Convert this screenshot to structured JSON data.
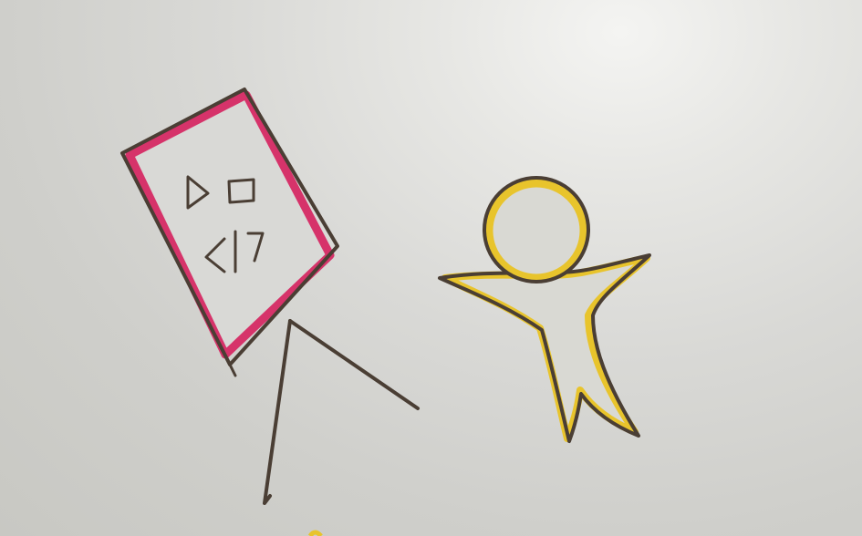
{
  "scene": {
    "description_elements": [
      "easel-board",
      "stick-figure-person"
    ],
    "colors": {
      "paper": "#d9d9d6",
      "ink": "#4a3e34",
      "board_accent": "#d6336a",
      "person_accent": "#e8c42c",
      "person_fill": "#d9d9d3"
    },
    "board_marks": [
      "triangle",
      "square",
      "<|>"
    ]
  }
}
